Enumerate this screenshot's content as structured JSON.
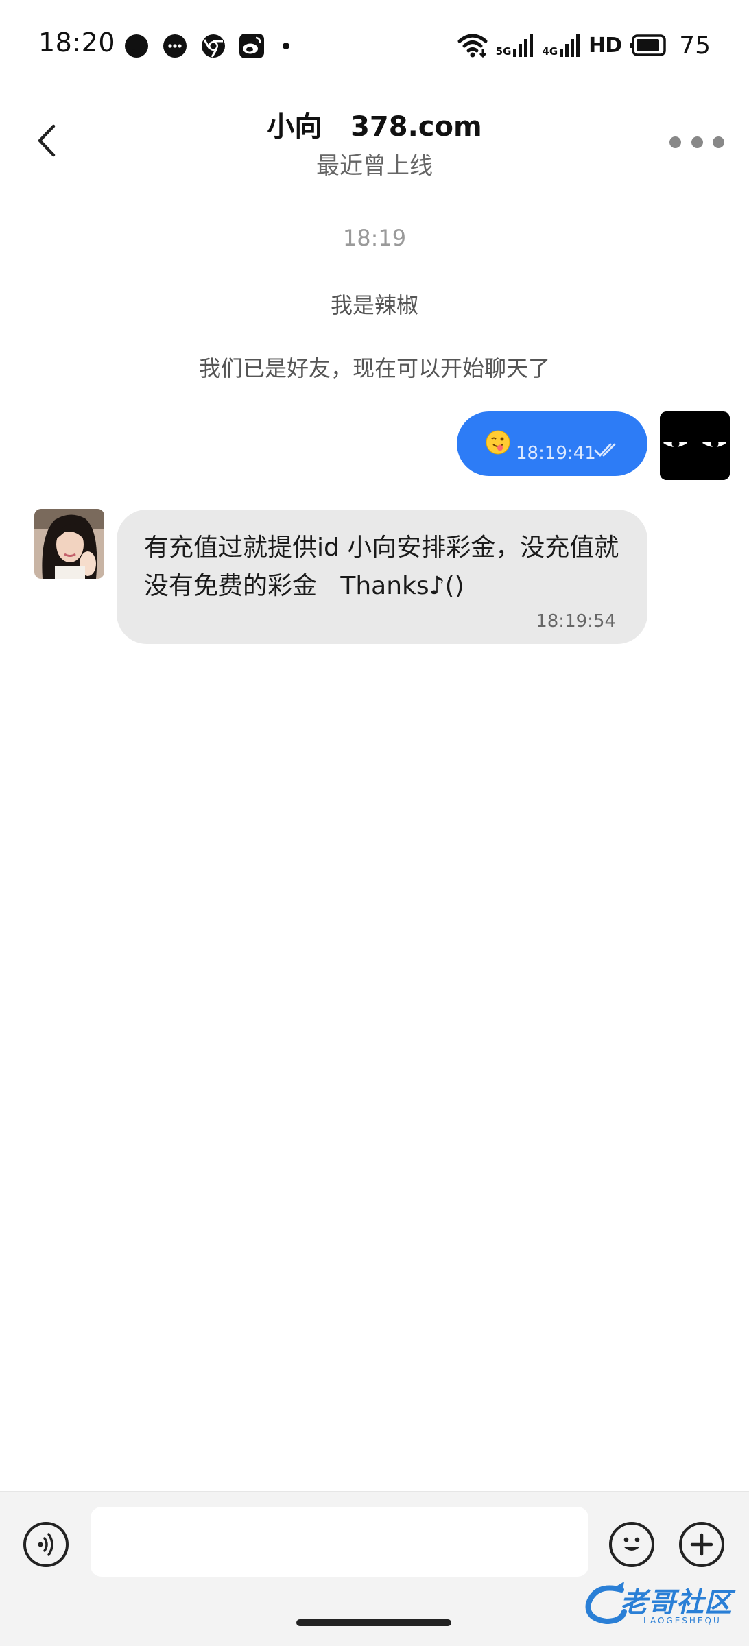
{
  "status_bar": {
    "time": "18:20",
    "net_5g": "5G",
    "net_4g": "4G",
    "hd": "HD",
    "battery": "75"
  },
  "header": {
    "title": "小向   378.com",
    "subtitle": "最近曾上线"
  },
  "chat": {
    "system_time": "18:19",
    "system_messages": [
      "我是辣椒",
      "我们已是好友，现在可以开始聊天了"
    ],
    "outgoing": {
      "time": "18:19:41"
    },
    "incoming": {
      "text": "有充值过就提供id 小向安排彩金，没充值就没有免费的彩金   Thanks♪()",
      "time": "18:19:54"
    }
  },
  "input": {
    "placeholder": ""
  },
  "watermark": {
    "text": "老哥社区",
    "sub": "LAOGESHEQU"
  },
  "colors": {
    "accent": "#2d7cf6",
    "incoming_bubble": "#e9e9e9",
    "input_bar": "#f3f3f3"
  }
}
